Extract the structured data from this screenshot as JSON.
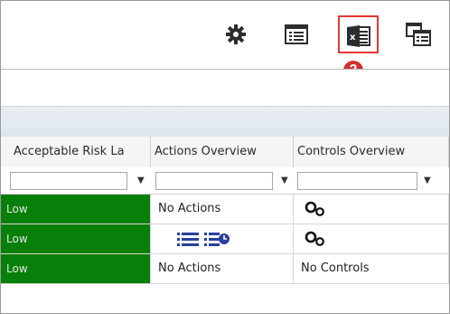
{
  "toolbar": {
    "icons": [
      "gear-icon",
      "grid-view-icon",
      "excel-export-icon",
      "multi-grid-icon"
    ],
    "badge_label": "2",
    "highlight_color": "#e53935",
    "badge_color": "#d32f2f"
  },
  "grid": {
    "columns": [
      "Acceptable Risk La",
      "Actions Overview",
      "Controls Overview"
    ],
    "filter_placeholders": [
      "",
      "",
      ""
    ],
    "rows": [
      {
        "risk": "Low",
        "actions": "No Actions",
        "controls": ""
      },
      {
        "risk": "Low",
        "actions": "",
        "controls": ""
      },
      {
        "risk": "Low",
        "actions": "No Actions",
        "controls": "No Controls"
      }
    ],
    "risk_color": "#087f08"
  }
}
